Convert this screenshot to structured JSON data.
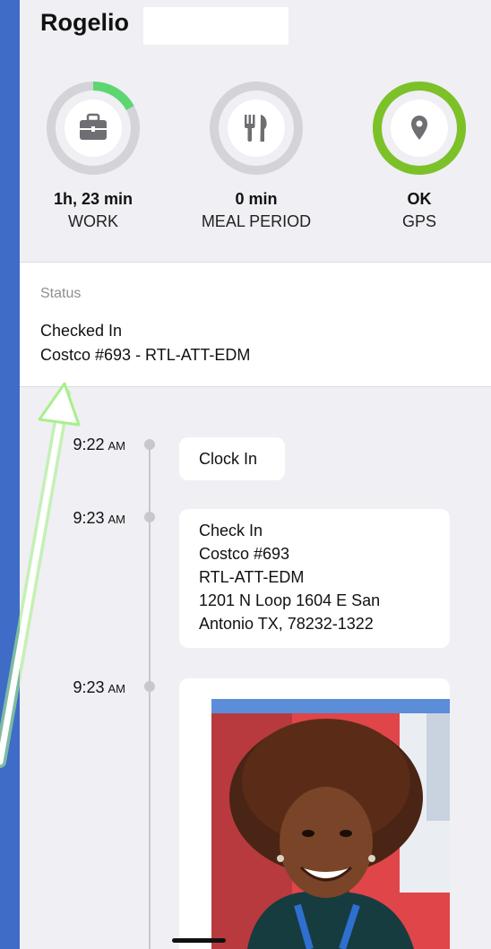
{
  "header": {
    "user_name": "Rogelio"
  },
  "stats": [
    {
      "icon": "briefcase-icon",
      "value": "1h, 23 min",
      "label": "WORK",
      "progress": 0.17,
      "ring_color": "#5dd672"
    },
    {
      "icon": "fork-knife-icon",
      "value": "0 min",
      "label": "MEAL PERIOD",
      "progress": 0.0,
      "ring_color": "#5dd672"
    },
    {
      "icon": "location-pin-icon",
      "value": "OK",
      "label": "GPS",
      "progress": 1.0,
      "ring_color": "#7cc128"
    }
  ],
  "status": {
    "title": "Status",
    "state": "Checked In",
    "location": "Costco #693 - RTL-ATT-EDM"
  },
  "timeline": [
    {
      "time": "9:22",
      "ampm": "AM",
      "lines": [
        "Clock In"
      ]
    },
    {
      "time": "9:23",
      "ampm": "AM",
      "lines": [
        "Check In",
        "Costco #693",
        "RTL-ATT-EDM",
        "1201 N Loop 1604 E San",
        "Antonio TX, 78232-1322"
      ]
    },
    {
      "time": "9:23",
      "ampm": "AM",
      "lines": []
    }
  ],
  "colors": {
    "background": "#3f6cc6",
    "screen": "#efeff4",
    "ring_track": "#d4d4d8",
    "gps_ring": "#7cc128",
    "work_ring": "#5dd672",
    "arrow_glow": "#a8f08a"
  }
}
